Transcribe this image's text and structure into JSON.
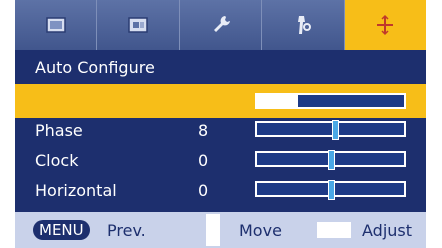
{
  "tabs": [
    {
      "icon": "picture-icon",
      "active": false
    },
    {
      "icon": "screen-icon",
      "active": false
    },
    {
      "icon": "wrench-icon",
      "active": false
    },
    {
      "icon": "settings-tool-icon",
      "active": false
    },
    {
      "icon": "crosshair-icon",
      "active": true
    }
  ],
  "menu": {
    "title": "Auto Configure",
    "auto_configure_progress": 0.28,
    "items": [
      {
        "label": "Phase",
        "value": "8",
        "level": 0.53
      },
      {
        "label": "Clock",
        "value": "0",
        "level": 0.5
      },
      {
        "label": "Horizontal",
        "value": "0",
        "level": 0.5
      }
    ]
  },
  "footer": {
    "menu_key": "MENU",
    "prev_label": "Prev.",
    "move_label": "Move",
    "adjust_label": "Adjust"
  },
  "colors": {
    "menu_background": "#1d2f6e",
    "highlight": "#f7be18",
    "slider_thumb": "#4aa9e6",
    "footer_background": "#c9d2ea"
  }
}
